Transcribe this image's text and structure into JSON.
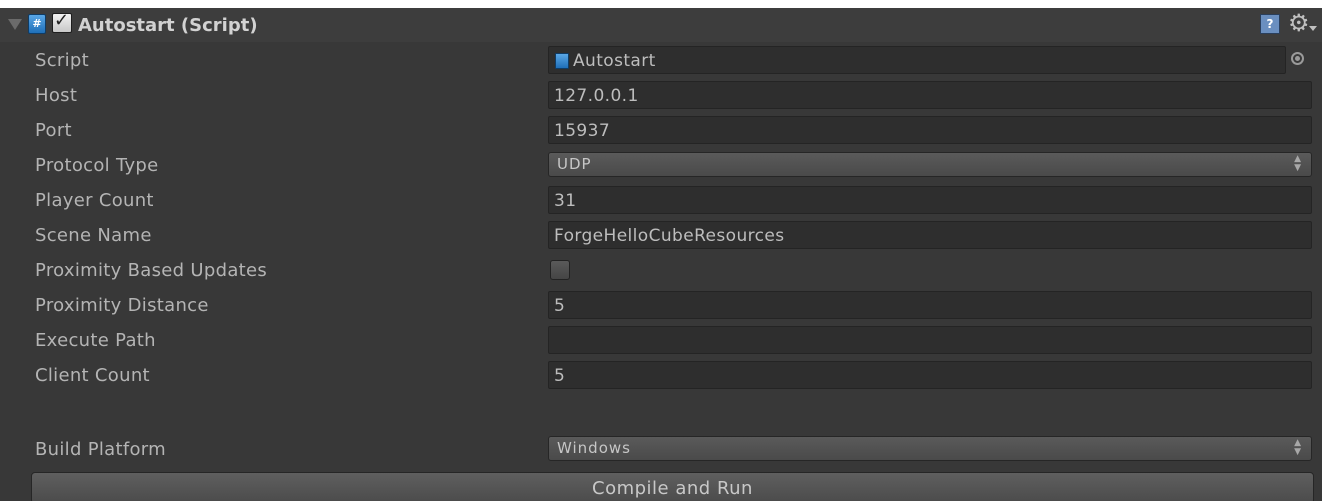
{
  "header": {
    "title": "Autostart (Script)",
    "enabled": true,
    "help_icon": "help-icon",
    "settings_icon": "gear-icon"
  },
  "fields": {
    "script": {
      "label": "Script",
      "value": "Autostart"
    },
    "host": {
      "label": "Host",
      "value": "127.0.0.1"
    },
    "port": {
      "label": "Port",
      "value": "15937"
    },
    "protocol_type": {
      "label": "Protocol Type",
      "value": "UDP"
    },
    "player_count": {
      "label": "Player Count",
      "value": "31"
    },
    "scene_name": {
      "label": "Scene Name",
      "value": "ForgeHelloCubeResources"
    },
    "proximity_based_updates": {
      "label": "Proximity Based Updates",
      "checked": false
    },
    "proximity_distance": {
      "label": "Proximity Distance",
      "value": "5"
    },
    "execute_path": {
      "label": "Execute Path",
      "value": ""
    },
    "client_count": {
      "label": "Client Count",
      "value": "5"
    },
    "build_platform": {
      "label": "Build Platform",
      "value": "Windows"
    }
  },
  "actions": {
    "compile_and_run": "Compile and Run"
  },
  "colors": {
    "panel_bg": "#383838",
    "field_bg": "#2e2e2e",
    "text": "#b4b4b4",
    "script_icon": "#3a8fd6"
  }
}
